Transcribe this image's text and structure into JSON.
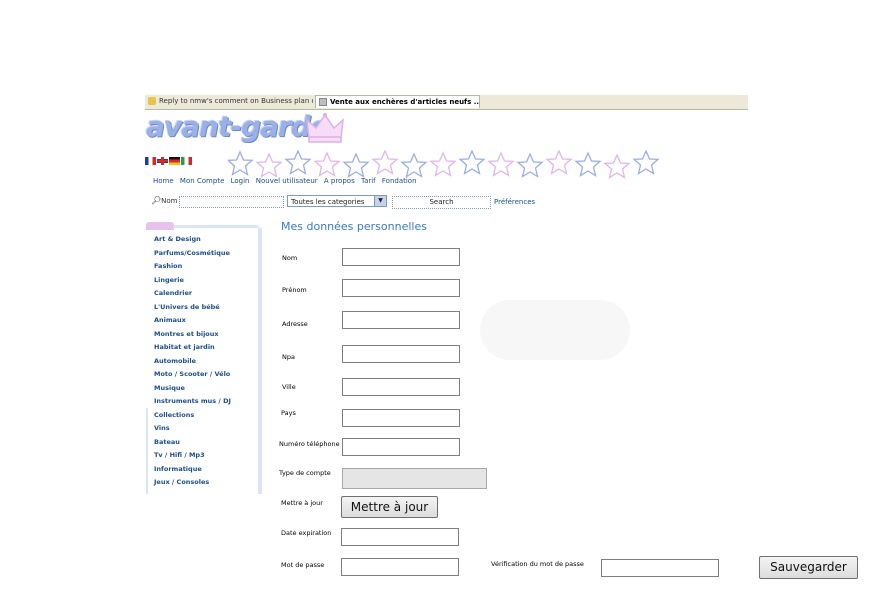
{
  "browser": {
    "tabs": [
      {
        "label": "Reply to nmw's comment on Business plan o..."
      },
      {
        "label": "Vente aux enchères d'articles neufs ..."
      }
    ]
  },
  "site": {
    "logo_text": "avant-garde",
    "languages": [
      "fr-flag",
      "gb-flag",
      "de-flag",
      "it-flag"
    ]
  },
  "nav": {
    "items": [
      "Home",
      "Mon Compte",
      "Login",
      "Nouvel utilisateur",
      "A propos",
      "Tarif",
      "Fondation"
    ]
  },
  "search": {
    "label": "Nom",
    "category_selected": "Toutes les categories",
    "button": "Search",
    "preferences": "Préférences"
  },
  "sidebar": {
    "categories": [
      "Art & Design",
      "Parfums/Cosmétique",
      "Fashion",
      "Lingerie",
      "Calendrier",
      "L'Univers de bébé",
      "Animaux",
      "Montres et bijoux",
      "Habitat et jardin",
      "Automobile",
      "Moto / Scooter / Vélo",
      "Musique",
      "Instruments mus / DJ",
      "Collections",
      "Vins",
      "Bateau",
      "Tv / Hifi / Mp3",
      "Informatique",
      "Jeux / Consoles"
    ]
  },
  "form": {
    "title": "Mes données personnelles",
    "labels": {
      "nom": "Nom",
      "prenom": "Prénom",
      "adresse": "Adresse",
      "npa": "Npa",
      "ville": "Ville",
      "pays": "Pays",
      "telephone": "Numéro téléphone",
      "type_compte": "Type de compte",
      "mettre_a_jour": "Mettre à jour",
      "date_expiration": "Date expiration",
      "mot_de_passe": "Mot de passe",
      "verification": "Vérification du mot de passe"
    },
    "values": {
      "nom": "",
      "prenom": "",
      "adresse": "",
      "npa": "",
      "ville": "",
      "pays": "",
      "telephone": "",
      "type_compte": "",
      "date_expiration": "",
      "mot_de_passe": "",
      "verification": ""
    },
    "update_button": "Mettre à jour",
    "save_button": "Sauvegarder"
  }
}
